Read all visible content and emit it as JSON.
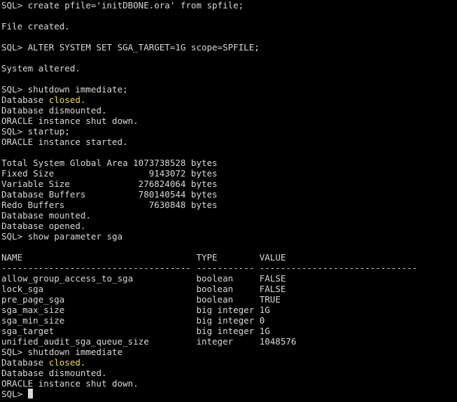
{
  "terminal": {
    "lines": [
      {
        "segments": [
          {
            "text": "SQL> create pfile='initDBONE.ora' from spfile;"
          }
        ]
      },
      {
        "segments": [
          {
            "text": ""
          }
        ]
      },
      {
        "segments": [
          {
            "text": "File created."
          }
        ]
      },
      {
        "segments": [
          {
            "text": ""
          }
        ]
      },
      {
        "segments": [
          {
            "text": "SQL> ALTER SYSTEM SET SGA_TARGET=1G scope=SPFILE;"
          }
        ]
      },
      {
        "segments": [
          {
            "text": ""
          }
        ]
      },
      {
        "segments": [
          {
            "text": "System altered."
          }
        ]
      },
      {
        "segments": [
          {
            "text": ""
          }
        ]
      },
      {
        "segments": [
          {
            "text": "SQL> shutdown immediate;"
          }
        ]
      },
      {
        "segments": [
          {
            "text": "Database "
          },
          {
            "text": "closed.",
            "highlight": true
          }
        ]
      },
      {
        "segments": [
          {
            "text": "Database dismounted."
          }
        ]
      },
      {
        "segments": [
          {
            "text": "ORACLE instance shut down."
          }
        ]
      },
      {
        "segments": [
          {
            "text": "SQL> startup;"
          }
        ]
      },
      {
        "segments": [
          {
            "text": "ORACLE instance started."
          }
        ]
      },
      {
        "segments": [
          {
            "text": ""
          }
        ]
      },
      {
        "segments": [
          {
            "text": "Total System Global Area 1073738528 bytes"
          }
        ]
      },
      {
        "segments": [
          {
            "text": "Fixed Size                  9143072 bytes"
          }
        ]
      },
      {
        "segments": [
          {
            "text": "Variable Size             276824064 bytes"
          }
        ]
      },
      {
        "segments": [
          {
            "text": "Database Buffers          780140544 bytes"
          }
        ]
      },
      {
        "segments": [
          {
            "text": "Redo Buffers                7630848 bytes"
          }
        ]
      },
      {
        "segments": [
          {
            "text": "Database mounted."
          }
        ]
      },
      {
        "segments": [
          {
            "text": "Database opened."
          }
        ]
      },
      {
        "segments": [
          {
            "text": "SQL> show parameter sga"
          }
        ]
      },
      {
        "segments": [
          {
            "text": ""
          }
        ]
      },
      {
        "segments": [
          {
            "text": "NAME                                 TYPE        VALUE"
          }
        ]
      },
      {
        "segments": [
          {
            "text": "------------------------------------ ----------- ------------------------------"
          }
        ]
      },
      {
        "segments": [
          {
            "text": "allow_group_access_to_sga            boolean     FALSE"
          }
        ]
      },
      {
        "segments": [
          {
            "text": "lock_sga                             boolean     FALSE"
          }
        ]
      },
      {
        "segments": [
          {
            "text": "pre_page_sga                         boolean     TRUE"
          }
        ]
      },
      {
        "segments": [
          {
            "text": "sga_max_size                         big integer 1G"
          }
        ]
      },
      {
        "segments": [
          {
            "text": "sga_min_size                         big integer 0"
          }
        ]
      },
      {
        "segments": [
          {
            "text": "sga_target                           big integer 1G"
          }
        ]
      },
      {
        "segments": [
          {
            "text": "unified_audit_sga_queue_size         integer     1048576"
          }
        ]
      },
      {
        "segments": [
          {
            "text": "SQL> shutdown immediate"
          }
        ]
      },
      {
        "segments": [
          {
            "text": "Database "
          },
          {
            "text": "closed.",
            "highlight": true
          }
        ]
      },
      {
        "segments": [
          {
            "text": "Database dismounted."
          }
        ]
      },
      {
        "segments": [
          {
            "text": "ORACLE instance shut down."
          }
        ]
      }
    ],
    "prompt": "SQL> ",
    "colors": {
      "background": "#000000",
      "foreground": "#d8d8d8",
      "highlight": "#e6e04a"
    }
  }
}
